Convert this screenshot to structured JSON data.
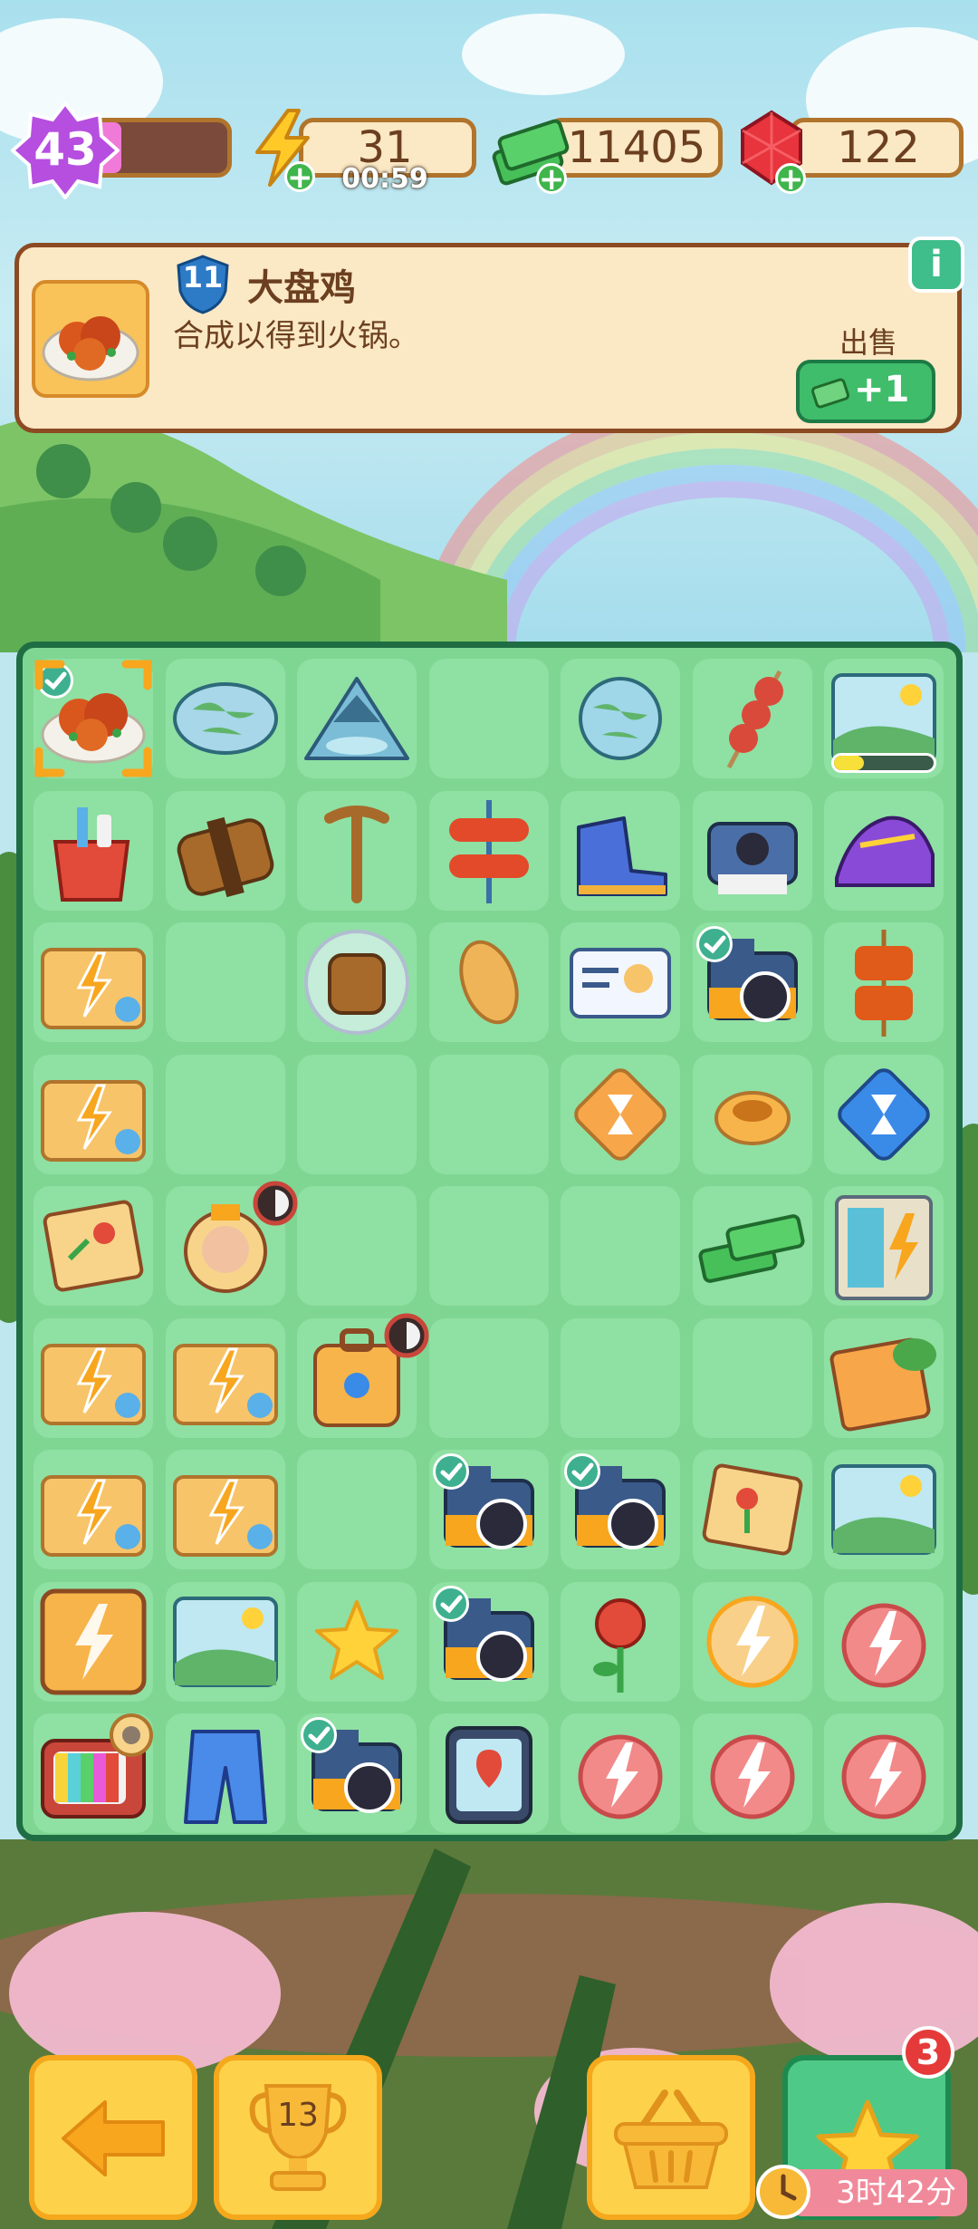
{
  "player": {
    "level": "43",
    "level_progress": 0.25
  },
  "resources": {
    "energy": {
      "value": "31",
      "timer": "00:59",
      "icon": "lightning-icon"
    },
    "cash": {
      "value": "11405",
      "icon": "cash-stack-icon"
    },
    "gems": {
      "value": "122",
      "icon": "ruby-icon"
    }
  },
  "info_panel": {
    "item_level": "11",
    "item_name": "大盘鸡",
    "item_desc": "合成以得到火锅。",
    "sell_label": "出售",
    "sell_value": "+1",
    "info_icon": "info-icon"
  },
  "board": {
    "columns": 7,
    "rows": 9,
    "items": [
      [
        "chicken-dish",
        "world-map-oval",
        "mountain-lake",
        "",
        "globe",
        "meat-skewer",
        "landscape-painting"
      ],
      [
        "toiletry-cup",
        "leather-bag",
        "walking-cane",
        "sausage-skewer",
        "hiking-boots",
        "instant-camera",
        "sneaker"
      ],
      [
        "energy-chest",
        "",
        "backpack-bubble",
        "bread-loaf",
        "id-card",
        "camera",
        "bbq-skewer"
      ],
      [
        "energy-chest",
        "",
        "",
        "",
        "hourglass-tile",
        "pudding",
        "hourglass-blue"
      ],
      [
        "postcard",
        "travel-badge",
        "",
        "",
        "",
        "cash-stack",
        "energy-cabinet"
      ],
      [
        "energy-chest",
        "energy-chest",
        "suitcase",
        "",
        "",
        "",
        "folder-notes"
      ],
      [
        "energy-chest",
        "energy-chest",
        "",
        "camera",
        "camera",
        "rose-postcard",
        "landscape-painting"
      ],
      [
        "energy-box-gold",
        "landscape-painting",
        "star-coin",
        "camera",
        "red-rose",
        "energy-coin",
        "energy-orb"
      ],
      [
        "retro-tv",
        "jeans",
        "camera",
        "map-tablet",
        "energy-orb",
        "energy-orb",
        "energy-orb"
      ]
    ],
    "checked": [
      [
        0,
        0
      ],
      [
        2,
        5
      ],
      [
        6,
        3
      ],
      [
        6,
        4
      ],
      [
        7,
        3
      ],
      [
        8,
        2
      ]
    ],
    "selected": [
      0,
      0
    ],
    "landscape_progress": 0.3
  },
  "bottom_bar": {
    "back_icon": "arrow-left-icon",
    "trophy_level": "13",
    "basket_icon": "basket-icon",
    "star_badge": "3",
    "star_timer": "3时42分"
  }
}
